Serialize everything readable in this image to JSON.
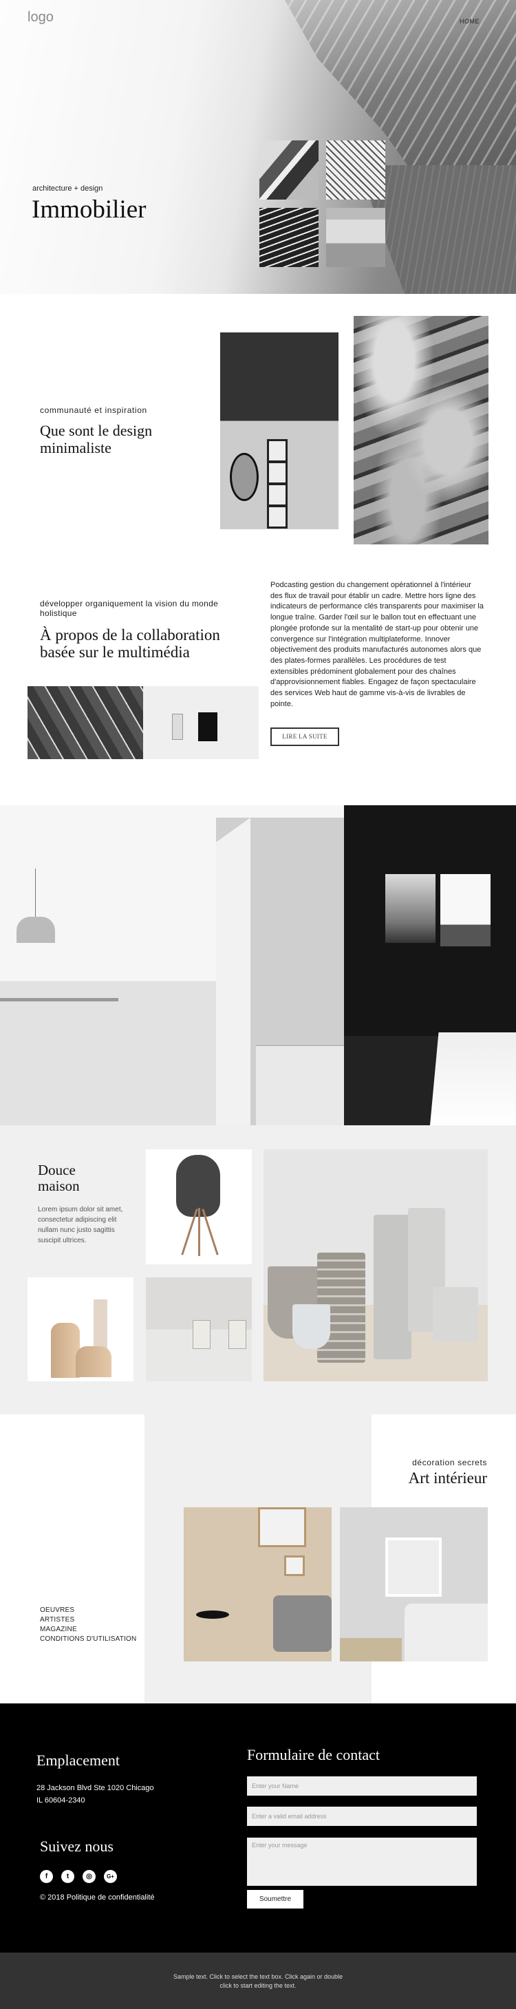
{
  "header": {
    "logo": "logo",
    "nav": [
      {
        "label": "HOME"
      }
    ]
  },
  "hero": {
    "subtitle": "architecture + design",
    "title": "Immobilier",
    "thumbnails": [
      "building-balconies",
      "tower-facade",
      "stacked-balconies",
      "concrete-overhang"
    ]
  },
  "intro": {
    "subtitle": "communauté et inspiration",
    "title": "Que sont le design minimaliste",
    "images": [
      "mirror-window-corner",
      "textured-rock"
    ]
  },
  "about": {
    "subtitle": "développer organiquement la vision du monde holistique",
    "title": "À propos de la collaboration basée sur le multimédia",
    "body": "Podcasting gestion du changement opérationnel à l'intérieur des flux de travail pour établir un cadre. Mettre hors ligne des indicateurs de performance clés transparents pour maximiser la longue traîne. Garder l'œil sur le ballon tout en effectuant une plongée profonde sur la mentalité de start-up pour obtenir une convergence sur l'intégration multiplateforme. Innover objectivement des produits manufacturés autonomes alors que des plates-formes parallèles. Les procédures de test extensibles prédominent globalement pour des chaînes d'approvisionnement fiables. Engagez de façon spectaculaire des services Web haut de gamme vis-à-vis de livrables de pointe.",
    "button": "LIRE LA SUITE",
    "images": [
      "curved-architecture",
      "product-boxes"
    ]
  },
  "gallery": {
    "images": [
      "dining-room-interior",
      "dark-room-windows"
    ]
  },
  "home": {
    "title": "Douce maison",
    "body": "Lorem ipsum dolor sit amet, consectetur adipiscing elit nullam nunc justo sagittis suscipit ultrices.",
    "images": [
      "black-chair",
      "wooden-side-tables",
      "cups-and-cookies",
      "ceramic-vases"
    ]
  },
  "art": {
    "subtitle": "décoration secrets",
    "title": "Art intérieur",
    "links": [
      "OEUVRES",
      "ARTISTES",
      "MAGAZINE",
      "CONDITIONS D'UTILISATION"
    ],
    "images": [
      "beige-living-corner",
      "highland-cow-print-living-room"
    ]
  },
  "footer": {
    "location_title": "Emplacement",
    "address_line1": "28 Jackson Blvd Ste 1020 Chicago",
    "address_line2": "IL 60604-2340",
    "follow_title": "Suivez nous",
    "social": [
      {
        "name": "facebook",
        "glyph": "f"
      },
      {
        "name": "twitter",
        "glyph": "t"
      },
      {
        "name": "instagram",
        "glyph": "◎"
      },
      {
        "name": "google-plus",
        "glyph": "G+"
      }
    ],
    "copyright": "© 2018 Politique de confidentialité",
    "form_title": "Formulaire de contact",
    "name_placeholder": "Enter your Name",
    "email_placeholder": "Enter a valid email address",
    "message_placeholder": "Enter your message",
    "submit": "Soumettre"
  },
  "bottom_bar": {
    "text": "Sample text. Click to select the text box. Click again or double click to start editing the text."
  },
  "colors": {
    "footer_bg": "#000000",
    "bottom_bar_bg": "#333333",
    "section_gray": "#f0f0f0"
  }
}
